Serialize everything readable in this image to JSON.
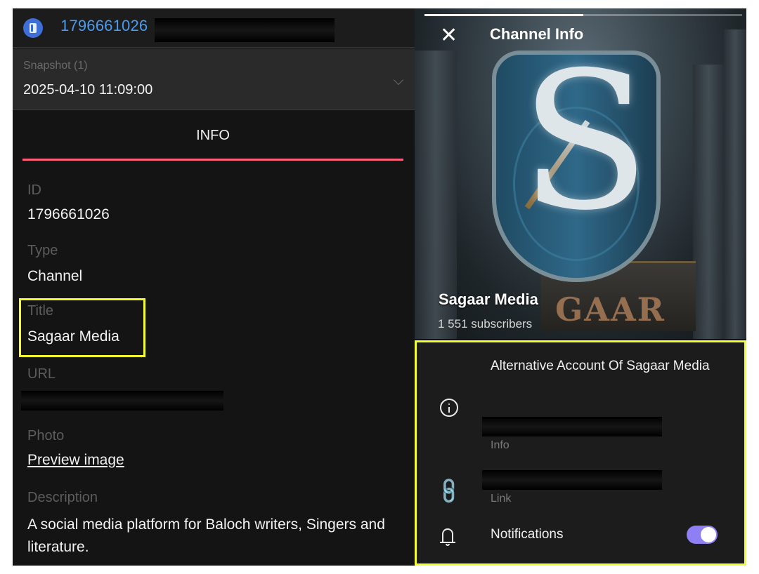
{
  "left": {
    "top_id": "1796661026",
    "snapshot_label": "Snapshot (1)",
    "snapshot_value": "2025-04-10 11:09:00",
    "tab_label": "INFO",
    "fields": {
      "id_label": "ID",
      "id_value": "1796661026",
      "type_label": "Type",
      "type_value": "Channel",
      "title_label": "Title",
      "title_value": "Sagaar Media",
      "url_label": "URL",
      "photo_label": "Photo",
      "photo_link": "Preview image",
      "description_label": "Description",
      "description_value": "A social media platform for Baloch writers, Singers and literature."
    },
    "icons": {
      "app": "document-app-icon",
      "chevron": "chevron-down-icon"
    }
  },
  "right": {
    "header_title": "Channel Info",
    "close_symbol": "✕",
    "story_progress": 0.5,
    "channel_name": "Sagaar Media",
    "subscribers": "1 551 subscribers",
    "watermark": "GAAR",
    "about": "Alternative Account Of Sagaar Media",
    "info_label": "Info",
    "link_label": "Link",
    "notifications_label": "Notifications",
    "notifications_on": true,
    "colors": {
      "toggle": "#8f7ff5",
      "highlight": "#f3ff2e",
      "tab_underline": "#ff5f7d",
      "link_blue": "#4a9cf0"
    },
    "icons": {
      "close": "close-icon",
      "info": "info-icon",
      "link": "link-icon",
      "bell": "bell-icon"
    }
  }
}
